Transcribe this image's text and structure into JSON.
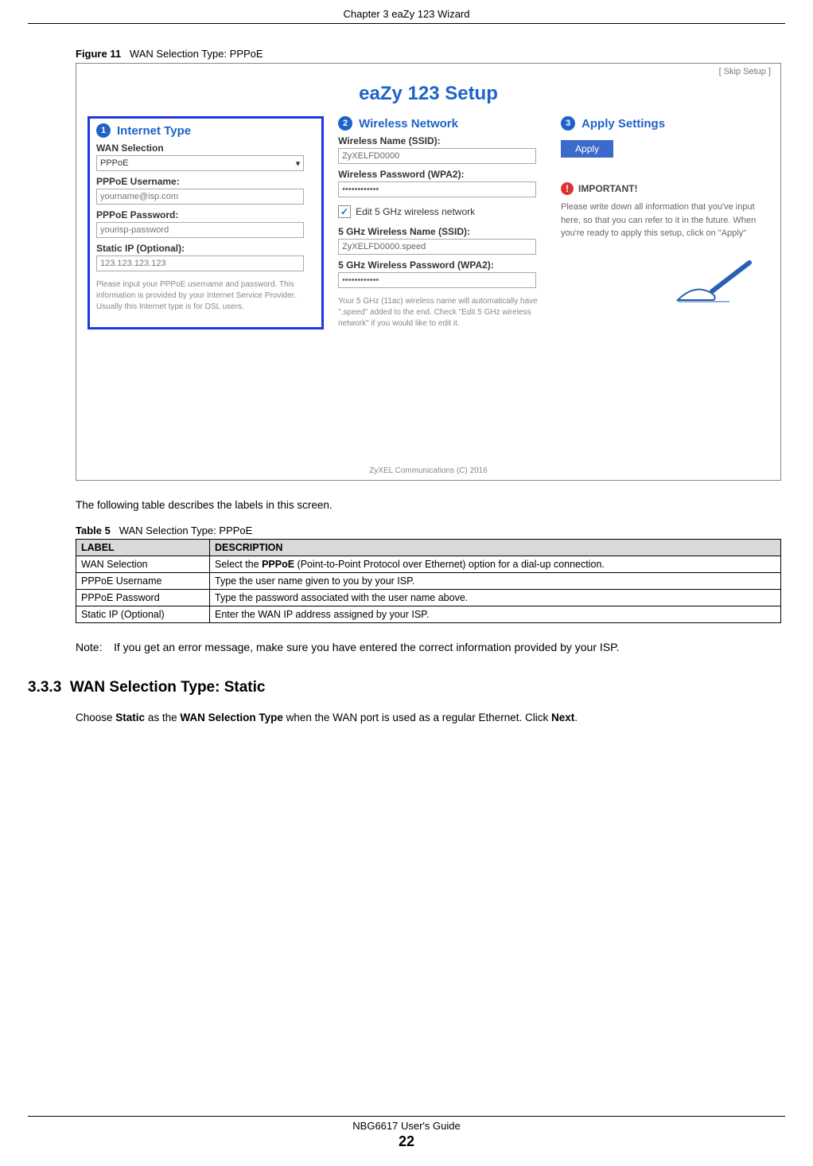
{
  "page": {
    "chapter_header": "Chapter 3 eaZy 123 Wizard",
    "footer_guide": "NBG6617 User's Guide",
    "page_number": "22"
  },
  "figure": {
    "label": "Figure 11",
    "title": "WAN Selection Type: PPPoE"
  },
  "screenshot": {
    "skip": "[ Skip Setup ]",
    "title": "eaZy 123 Setup",
    "copyright": "ZyXEL Communications (C) 2016",
    "col1": {
      "step_num": "1",
      "step_title": "Internet Type",
      "wan_sel_label": "WAN Selection",
      "wan_sel_value": "PPPoE",
      "user_label": "PPPoE Username:",
      "user_ph": "yourname@isp.com",
      "pass_label": "PPPoE Password:",
      "pass_ph": "yourisp-password",
      "static_label": "Static IP (Optional):",
      "static_ph": "123.123.123.123",
      "note": "Please input your PPPoE username and password. This information is provided by your Internet Service Provider. Usually this Internet type is for DSL users."
    },
    "col2": {
      "step_num": "2",
      "step_title": "Wireless Network",
      "ssid_label": "Wireless Name (SSID):",
      "ssid_val": "ZyXELFD0000",
      "wpa_label": "Wireless Password (WPA2):",
      "wpa_val": "••••••••••••",
      "edit5_label": "Edit 5 GHz wireless network",
      "ssid5_label": "5 GHz Wireless Name (SSID):",
      "ssid5_val": "ZyXELFD0000.speed",
      "wpa5_label": "5 GHz Wireless Password (WPA2):",
      "wpa5_val": "••••••••••••",
      "note": "Your 5 GHz (11ac) wireless name will automatically have \".speed\" added to the end. Check \"Edit 5 GHz wireless network\" if you would like to edit it."
    },
    "col3": {
      "step_num": "3",
      "step_title": "Apply Settings",
      "apply_btn": "Apply",
      "imp_title": "IMPORTANT!",
      "imp_text": "Please write down all information that you've input here, so that you can refer to it in the future. When you're ready to apply this setup, click on \"Apply\""
    }
  },
  "intro_text": "The following table describes the labels in this screen.",
  "table": {
    "label": "Table 5",
    "title": "WAN Selection Type: PPPoE",
    "header_label": "LABEL",
    "header_desc": "DESCRIPTION",
    "rows": [
      {
        "label": "WAN Selection",
        "desc_pre": "Select the ",
        "desc_bold": "PPPoE",
        "desc_post": " (Point-to-Point Protocol over Ethernet) option for a dial-up connection."
      },
      {
        "label": "PPPoE Username",
        "desc": "Type the user name given to you by your ISP."
      },
      {
        "label": "PPPoE Password",
        "desc": "Type the password associated with the user name above."
      },
      {
        "label": "Static IP (Optional)",
        "desc": "Enter the WAN IP address assigned by your ISP."
      }
    ]
  },
  "note_label": "Note: ",
  "note_text": "If you get an error message, make sure you have entered the correct information provided by your ISP.",
  "section": {
    "num": "3.3.3",
    "title": "WAN Selection Type: Static",
    "p1a": "Choose ",
    "p1b": "Static",
    "p1c": " as the ",
    "p1d": "WAN Selection Type",
    "p1e": " when the WAN port is used as a regular Ethernet. Click ",
    "p1f": "Next",
    "p1g": "."
  }
}
